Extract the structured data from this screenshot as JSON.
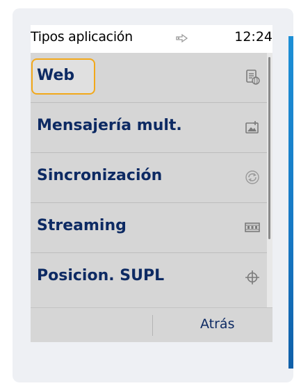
{
  "status_bar": {
    "title": "Tipos aplicación",
    "connection_icon": "link-icon",
    "time": "12:24"
  },
  "list": {
    "selected_index": 0,
    "items": [
      {
        "label": "Web",
        "icon": "web-page-icon"
      },
      {
        "label": "Mensajería mult.",
        "icon": "multimedia-message-icon"
      },
      {
        "label": "Sincronización",
        "icon": "sync-icon"
      },
      {
        "label": "Streaming",
        "icon": "film-strip-icon"
      },
      {
        "label": "Posicion. SUPL",
        "icon": "crosshair-icon"
      }
    ]
  },
  "softkeys": {
    "left": "",
    "right": "Atrás"
  },
  "colors": {
    "list_background": "#d6d6d6",
    "label_text": "#0d2a63",
    "focus_outline": "#f2a81a",
    "frame_accent": "#1678c4"
  }
}
